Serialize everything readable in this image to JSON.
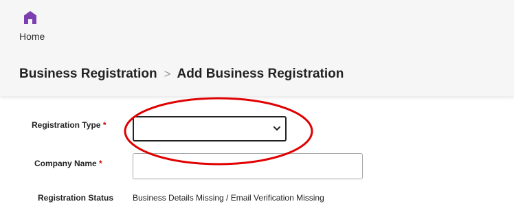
{
  "nav": {
    "home_label": "Home",
    "home_icon": "home-icon",
    "icon_color": "#7b3fb0"
  },
  "breadcrumb": {
    "parent": "Business Registration",
    "separator": ">",
    "current": "Add Business Registration"
  },
  "form": {
    "registration_type": {
      "label": "Registration Type",
      "required_mark": "*",
      "selected_value": ""
    },
    "company_name": {
      "label": "Company Name",
      "required_mark": "*",
      "value": ""
    },
    "registration_status": {
      "label": "Registration Status",
      "value": "Business Details Missing / Email Verification Missing"
    }
  },
  "annotation": {
    "shape": "ellipse",
    "color": "#e00000"
  }
}
